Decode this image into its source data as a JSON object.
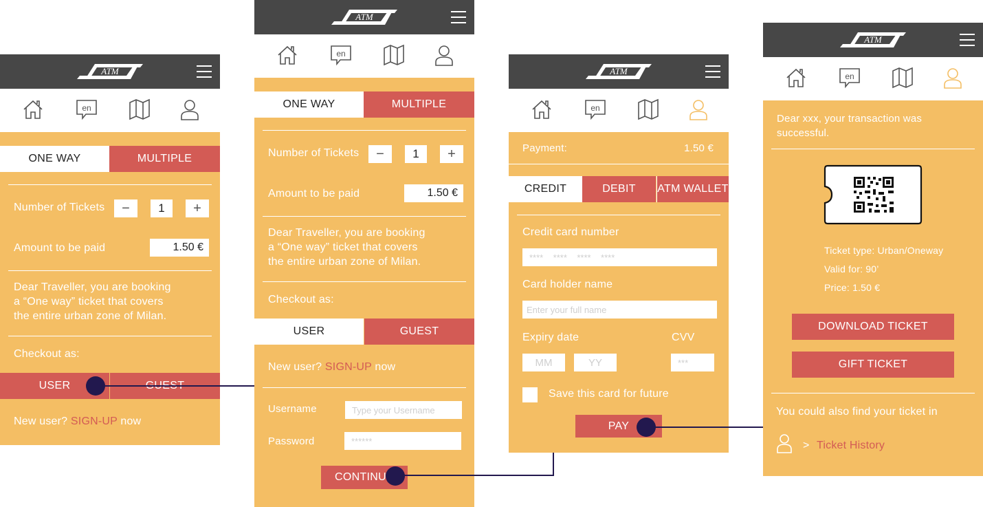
{
  "app": {
    "logo_text": "ATM"
  },
  "colors": {
    "screen_bg": "#F4BE64",
    "header_bg": "#474747",
    "accent_red": "#D35B55",
    "connector": "#22184E",
    "active_icon": "#F4BE64"
  },
  "nav_icons": [
    "home-icon",
    "language-en-icon",
    "map-icon",
    "user-icon"
  ],
  "nav": {
    "language_label": "en"
  },
  "screen1": {
    "tabs": {
      "one_way": "ONE WAY",
      "multiple": "MULTIPLE"
    },
    "tickets_label": "Number of Tickets",
    "minus": "−",
    "plus": "+",
    "ticket_count": "1",
    "amount_label": "Amount to be paid",
    "amount_value": "1.50 €",
    "info_line1": "Dear Traveller, you are booking",
    "info_line2": "a “One way” ticket that covers",
    "info_line3": "the entire urban zone of Milan.",
    "checkout_label": "Checkout as:",
    "user_tab": "USER",
    "guest_tab": "GUEST",
    "new_user_prefix": "New user? ",
    "signup_link": "SIGN-UP",
    "new_user_suffix": " now"
  },
  "screen2": {
    "tabs": {
      "one_way": "ONE WAY",
      "multiple": "MULTIPLE"
    },
    "tickets_label": "Number of Tickets",
    "minus": "−",
    "plus": "+",
    "ticket_count": "1",
    "amount_label": "Amount to be paid",
    "amount_value": "1.50 €",
    "info_line1": "Dear Traveller, you are booking",
    "info_line2": "a  “One way” ticket that covers",
    "info_line3": "the entire urban zone of Milan.",
    "checkout_label": "Checkout as:",
    "user_tab": "USER",
    "guest_tab": "GUEST",
    "new_user_prefix": "New user? ",
    "signup_link": "SIGN-UP",
    "new_user_suffix": " now",
    "username_label": "Username",
    "username_placeholder": "Type your Username",
    "password_label": "Password",
    "password_placeholder": "******",
    "continue_button": "CONTINUE"
  },
  "screen3": {
    "payment_label": "Payment:",
    "payment_value": "1.50 €",
    "tabs": {
      "credit": "CREDIT",
      "debit": "DEBIT",
      "wallet": "ATM WALLET"
    },
    "card_number_label": "Credit card number",
    "card_number_placeholder": "****    ****    ****    ****",
    "holder_label": "Card holder name",
    "holder_placeholder": "Enter your full name",
    "expiry_label": "Expiry date",
    "cvv_label": "CVV",
    "mm_placeholder": "MM",
    "yy_placeholder": "YY",
    "cvv_placeholder": "***",
    "save_card_label": "Save this card for future",
    "pay_button": "PAY"
  },
  "screen4": {
    "success_line1": "Dear xxx, your transaction was",
    "success_line2": "successful.",
    "ticket_type": "Ticket type: Urban/Oneway",
    "valid_for": "Valid for: 90’",
    "price": "Price: 1.50 €",
    "download_button": "DOWNLOAD TICKET",
    "gift_button": "GIFT TICKET",
    "find_text": "You could also find your ticket in",
    "arrow": ">",
    "history_link": "Ticket History"
  }
}
